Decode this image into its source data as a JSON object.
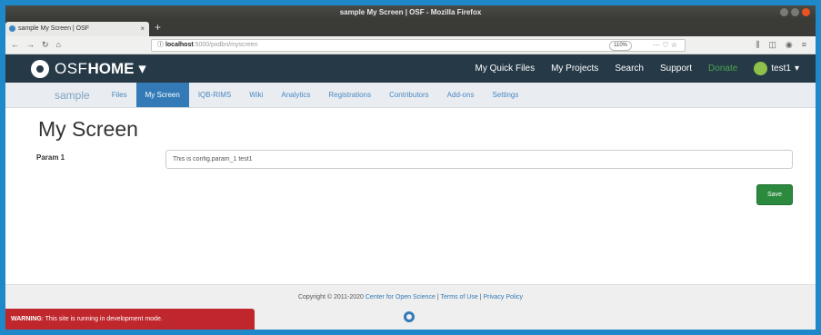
{
  "window": {
    "title": "sample My Screen | OSF - Mozilla Firefox"
  },
  "browser": {
    "tab_label": "sample My Screen | OSF",
    "tab_close": "×",
    "new_tab": "+",
    "url_host": "localhost",
    "url_path": ":5000/pxdbn/myscreen",
    "zoom": "110%",
    "url_actions": "··· ♡ ☆"
  },
  "osf": {
    "brand_osf": "OSF",
    "brand_home": "HOME",
    "brand_caret": "▾",
    "menu": {
      "quick_files": "My Quick Files",
      "projects": "My Projects",
      "search": "Search",
      "support": "Support",
      "donate": "Donate",
      "user": "test1",
      "user_caret": "▾"
    }
  },
  "project_nav": {
    "project": "sample",
    "items": [
      "Files",
      "My Screen",
      "IQB-RIMS",
      "Wiki",
      "Analytics",
      "Registrations",
      "Contributors",
      "Add-ons",
      "Settings"
    ]
  },
  "main": {
    "title": "My Screen",
    "param_label": "Param 1",
    "param_value": "This is config.param_1 test1",
    "save_label": "Save"
  },
  "footer": {
    "copyright": "Copyright © 2011-2020",
    "cos": "Center for Open Science",
    "sep1": " | ",
    "terms": "Terms of Use",
    "sep2": " | ",
    "privacy": "Privacy Policy"
  },
  "warning": {
    "prefix": "WARNING",
    "text": ": This site is running in development mode."
  },
  "colors": {
    "osf_header": "#263947",
    "active_tab": "#337ab7",
    "donate": "#4aa651",
    "save": "#2b8a3e",
    "warning": "#c0272d"
  }
}
